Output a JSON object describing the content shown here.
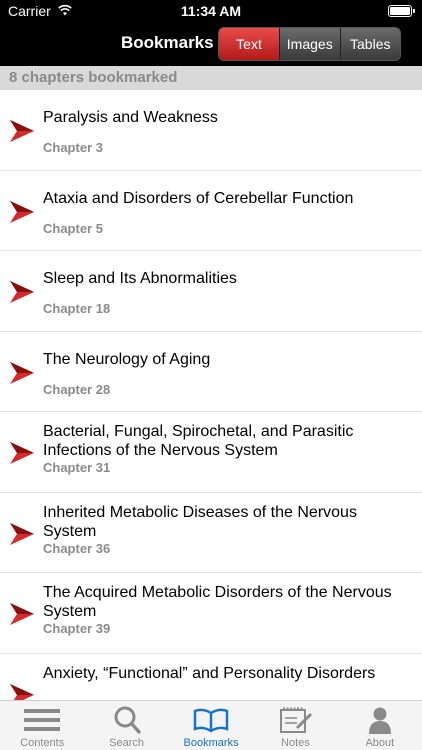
{
  "status_bar": {
    "carrier": "Carrier",
    "time": "11:34 AM"
  },
  "nav": {
    "title": "Bookmarks",
    "segments": [
      {
        "label": "Text",
        "active": true
      },
      {
        "label": "Images",
        "active": false
      },
      {
        "label": "Tables",
        "active": false
      }
    ]
  },
  "header": {
    "count_text": "8 chapters bookmarked"
  },
  "bookmarks": [
    {
      "title": "Paralysis and Weakness",
      "chapter": "Chapter 3"
    },
    {
      "title": "Ataxia and Disorders of Cerebellar Function",
      "chapter": "Chapter 5"
    },
    {
      "title": "Sleep and Its Abnormalities",
      "chapter": "Chapter 18"
    },
    {
      "title": "The Neurology of Aging",
      "chapter": "Chapter 28"
    },
    {
      "title": "Bacterial, Fungal, Spirochetal, and Parasitic Infections of the Nervous System",
      "chapter": "Chapter 31"
    },
    {
      "title": "Inherited Metabolic Diseases of the Nervous System",
      "chapter": "Chapter 36"
    },
    {
      "title": "The Acquired Metabolic Disorders of the Nervous System",
      "chapter": "Chapter 39"
    },
    {
      "title": "Anxiety, “Functional” and Personality Disorders",
      "chapter": ""
    }
  ],
  "tabs": [
    {
      "label": "Contents",
      "icon": "list-icon",
      "active": false
    },
    {
      "label": "Search",
      "icon": "search-icon",
      "active": false
    },
    {
      "label": "Bookmarks",
      "icon": "book-icon",
      "active": true
    },
    {
      "label": "Notes",
      "icon": "notepad-icon",
      "active": false
    },
    {
      "label": "About",
      "icon": "person-icon",
      "active": false
    }
  ],
  "colors": {
    "accent_red": "#d42a2a",
    "tab_active": "#1a72c8",
    "tab_inactive": "#8a8a8a"
  }
}
